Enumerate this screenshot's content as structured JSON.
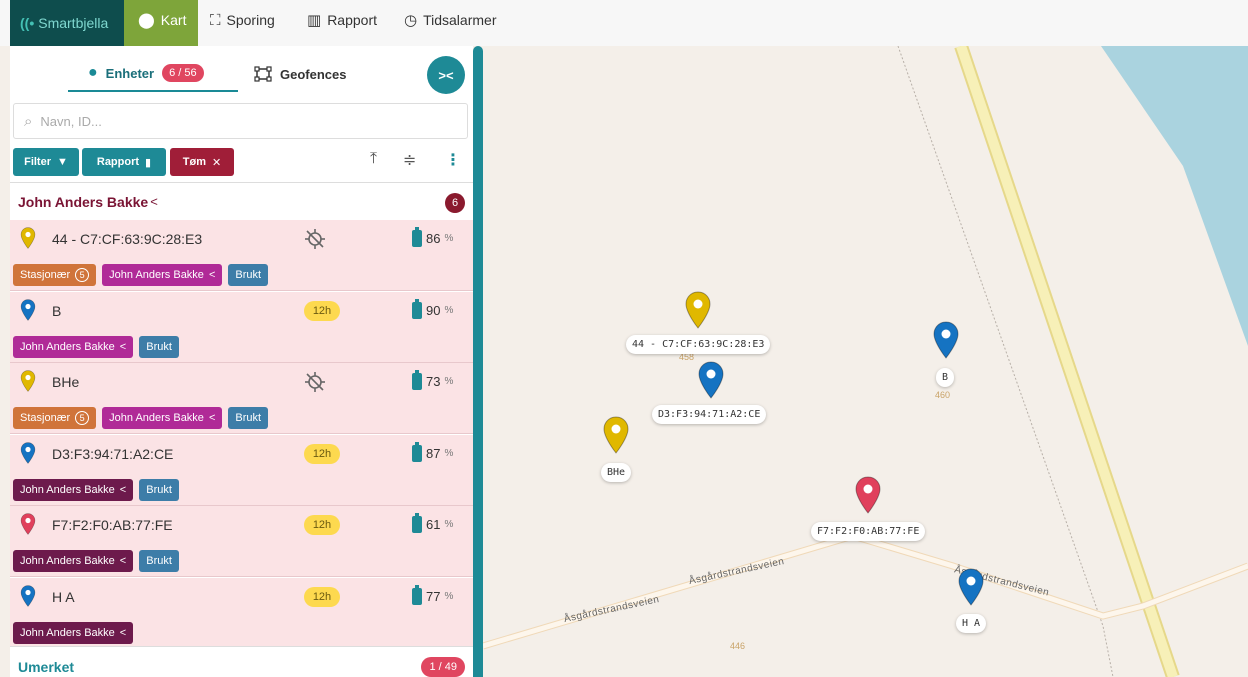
{
  "nav": {
    "brand": "Smartbjella",
    "items": [
      {
        "label": "Kart",
        "active": true
      },
      {
        "label": "Sporing"
      },
      {
        "label": "Rapport"
      },
      {
        "label": "Tidsalarmer"
      }
    ]
  },
  "sidebar": {
    "tabs": {
      "units_label": "Enheter",
      "units_count": "6 / 56",
      "geofences_label": "Geofences"
    },
    "collapse_label": "><",
    "search": {
      "placeholder": "Navn, ID...",
      "value": ""
    },
    "toolbar": {
      "filter_label": "Filter",
      "report_label": "Rapport",
      "clear_label": "Tøm"
    },
    "group": {
      "title": "John Anders Bakke",
      "count": "6"
    },
    "units": [
      {
        "name": "44 - C7:CF:63:9C:28:E3",
        "color": "#e0b800",
        "status": "no-gps",
        "battery": "86",
        "tags": [
          "stationary",
          "owner",
          "used"
        ]
      },
      {
        "name": "B",
        "color": "#1573c2",
        "status": "12h",
        "battery": "90",
        "tags": [
          "owner",
          "used"
        ]
      },
      {
        "name": "BHe",
        "color": "#e0b800",
        "status": "no-gps",
        "battery": "73",
        "tags": [
          "stationary",
          "owner",
          "used"
        ]
      },
      {
        "name": "D3:F3:94:71:A2:CE",
        "color": "#1573c2",
        "status": "12h",
        "battery": "87",
        "tags": [
          "owner",
          "used"
        ]
      },
      {
        "name": "F7:F2:F0:AB:77:FE",
        "color": "#e0405c",
        "status": "12h",
        "battery": "61",
        "tags": [
          "owner",
          "used"
        ]
      },
      {
        "name": "H A",
        "color": "#1573c2",
        "status": "12h",
        "battery": "77",
        "tags": [
          "owner"
        ]
      }
    ],
    "tag_labels": {
      "stationary": "Stasjonær",
      "stationary_num": "5",
      "owner": "John Anders Bakke",
      "used": "Brukt"
    },
    "pct_sign": "%",
    "group2": {
      "title": "Umerket",
      "count": "1 / 49"
    }
  },
  "map": {
    "road_name": "Åsgårdstrandsveien",
    "numbers": [
      "458",
      "460",
      "446"
    ],
    "markers": [
      {
        "label": "44 - C7:CF:63:9C:28:E3",
        "color": "#e0b800"
      },
      {
        "label": "B",
        "color": "#1573c2"
      },
      {
        "label": "D3:F3:94:71:A2:CE",
        "color": "#1573c2"
      },
      {
        "label": "BHe",
        "color": "#e0b800"
      },
      {
        "label": "F7:F2:F0:AB:77:FE",
        "color": "#e0405c"
      },
      {
        "label": "H A",
        "color": "#1573c2"
      }
    ]
  }
}
